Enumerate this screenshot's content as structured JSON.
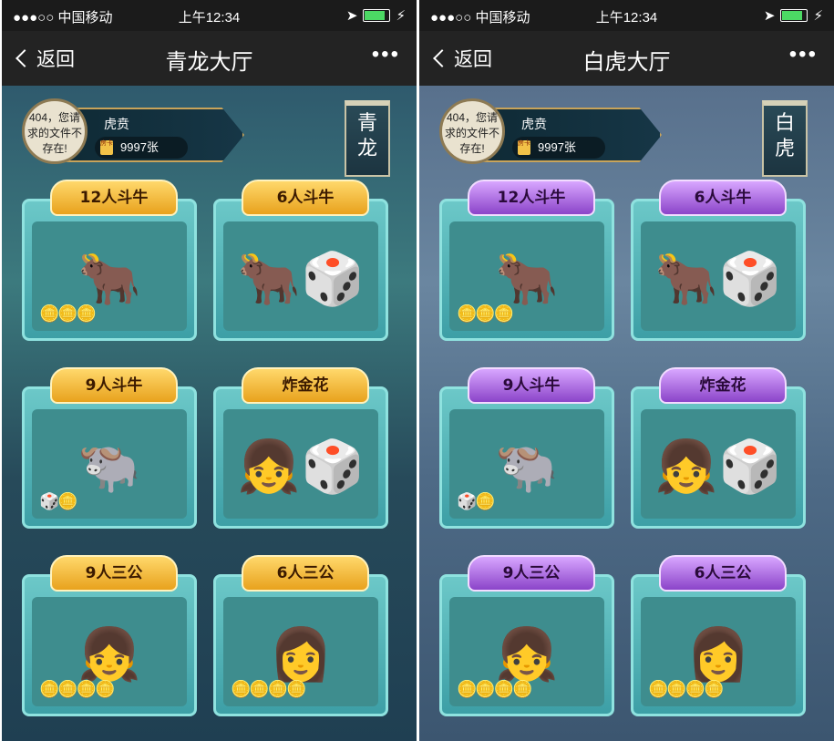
{
  "status_bar": {
    "carrier": "●●●○○ 中国移动",
    "time": "上午12:34"
  },
  "nav": {
    "back_label": "返回",
    "more_label": "•••"
  },
  "profile": {
    "avatar_text": "404，您请求的文件不存在!",
    "name": "虎贲",
    "card_count": "9997张",
    "card_icon_text": "房卡"
  },
  "games": [
    {
      "label": "12人斗牛"
    },
    {
      "label": "6人斗牛"
    },
    {
      "label": "9人斗牛"
    },
    {
      "label": "炸金花"
    },
    {
      "label": "9人三公"
    },
    {
      "label": "6人三公"
    }
  ],
  "phones": [
    {
      "title": "青龙大厅",
      "hall_tag": [
        "青",
        "龙"
      ],
      "accent": "#e8a21d"
    },
    {
      "title": "白虎大厅",
      "hall_tag": [
        "白",
        "虎"
      ],
      "accent": "#8b44c9"
    }
  ]
}
